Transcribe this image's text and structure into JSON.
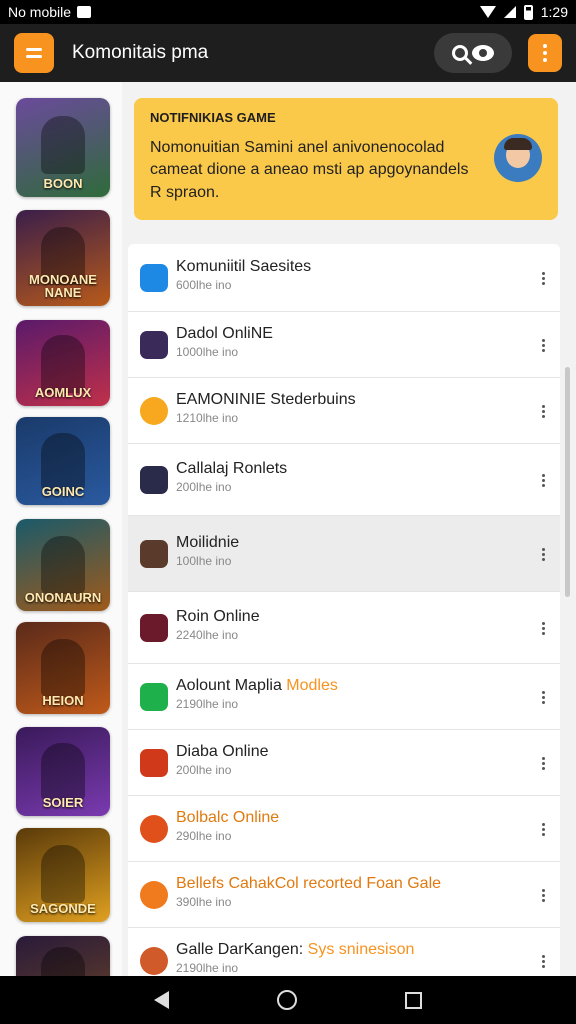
{
  "status_bar": {
    "carrier": "No mobile",
    "time": "1:29"
  },
  "app_bar": {
    "title": "Komonitais pma"
  },
  "banner": {
    "title": "NOTIFNIKIAS GAME",
    "text": "Nomonuitian Samini anel anivonenocolad cameat dione a aneao msti ap apgoynandels R spraon."
  },
  "sidebar": {
    "tiles": [
      {
        "label": "BOON",
        "colors": [
          "#6b4a9c",
          "#2f6b3a"
        ]
      },
      {
        "label": "MONOANE NANE",
        "colors": [
          "#3a1e4a",
          "#b85a1a"
        ]
      },
      {
        "label": "AOMLUX",
        "colors": [
          "#5a1a6a",
          "#c0304a"
        ]
      },
      {
        "label": "GOINC",
        "colors": [
          "#1a3a6a",
          "#2a5aa0"
        ]
      },
      {
        "label": "ONONAURN",
        "colors": [
          "#1a5a6a",
          "#a05a1a"
        ]
      },
      {
        "label": "HEION",
        "colors": [
          "#5a2a1a",
          "#c05a1a"
        ]
      },
      {
        "label": "SOIER",
        "colors": [
          "#3a1a5a",
          "#7a3ab0"
        ]
      },
      {
        "label": "SAGONDE",
        "colors": [
          "#5a3a0a",
          "#e0a020"
        ]
      },
      {
        "label": "",
        "colors": [
          "#2a1a3a",
          "#5a3a2a"
        ]
      }
    ]
  },
  "list": {
    "items": [
      {
        "name": "Komuniitil Saesites",
        "accent": "",
        "sub": "600lhe ino",
        "icon": "#1e88e5",
        "style": "normal"
      },
      {
        "name": "Dadol OnliNE",
        "accent": "",
        "sub": "1000lhe ino",
        "icon": "#3a2a5a",
        "style": "normal"
      },
      {
        "name": "EAMONINIE Stederbuins",
        "accent": "",
        "sub": "1210lhe ino",
        "icon": "#f7a81e",
        "style": "normal"
      },
      {
        "name": "Callalaj Ronlets",
        "accent": "",
        "sub": "200lhe ino",
        "icon": "#2a2a4a",
        "style": "normal"
      },
      {
        "name": "Moilidnie",
        "accent": "",
        "sub": "100lhe ino",
        "icon": "#5a3a2a",
        "style": "highlight"
      },
      {
        "name": "Roin Online",
        "accent": "",
        "sub": "2240lhe ino",
        "icon": "#6a1a2a",
        "style": "normal"
      },
      {
        "name": "Aolount Maplia ",
        "accent": "Modles",
        "sub": "2190lhe ino",
        "icon": "#1eb04a",
        "style": "normal"
      },
      {
        "name": "Diaba Online",
        "accent": "",
        "sub": "200lhe ino",
        "icon": "#d03a1a",
        "style": "normal"
      },
      {
        "name": "Bolbalc Online",
        "accent": "",
        "sub": "290lhe ino",
        "icon": "#e0501a",
        "style": "orange"
      },
      {
        "name": "Bellefs CahakCol recorted Foan Gale",
        "accent": "",
        "sub": "390lhe ino",
        "icon": "#f07a1e",
        "style": "orange"
      },
      {
        "name": "Galle DarKangen: ",
        "accent": "Sys sninesison",
        "sub": "2190lhe ino",
        "icon": "#d05a2a",
        "style": "normal"
      }
    ]
  }
}
